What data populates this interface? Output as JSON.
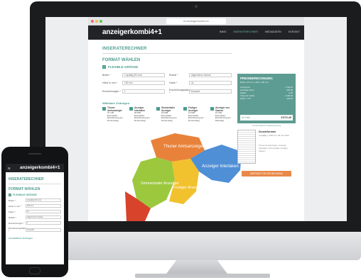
{
  "site": {
    "logo_text": "anzeigerkombi",
    "logo_num": "4+1",
    "url": "bi.anzeigerkombi.ch"
  },
  "nav": [
    "IMMO",
    "INSERATERECHNER",
    "MEDIADATEN",
    "KONTAKT"
  ],
  "main": {
    "title": "INSERATERECHNER",
    "format_title": "FORMAT WÄHLEN",
    "flex_label": "FLEXIBLE GRÖSSE",
    "fields": [
      {
        "label": "Breite *",
        "value": "2-spaltig (92 mm)"
      },
      {
        "label": "Rubrik *",
        "value": "Allgemeiner Inserat"
      },
      {
        "label": "Höhe in mm *",
        "value": "100 mm"
      },
      {
        "label": "Farbe *",
        "value": "4c"
      },
      {
        "label": "Erscheinungen *",
        "value": "1"
      },
      {
        "label": "Erscheinungsdatum *",
        "value": "Auswahl"
      }
    ],
    "regions_title": "Wählbare Zeitungen",
    "regions": [
      {
        "name": "Thuner Amtsanzeiger",
        "detail": "37 135 Exemplare Erscheinung am Donnerstag"
      },
      {
        "name": "Anzeiger Interlaken",
        "detail": "28 850 Exemplare Erscheinung am Donnerstag"
      },
      {
        "name": "Simmentaler Anzeiger",
        "detail": "18 508 Exemplare Erscheinung am Donnerstag"
      },
      {
        "name": "Frutiger Anzeiger",
        "detail": "14 845 Exemplare Erscheinung am Donnerstag"
      },
      {
        "name": "Anzeiger von Saanen",
        "detail": "10 636 Exemplare Erscheinung am Dienstag"
      }
    ],
    "map_labels": [
      "Thuner Amtsanzeiger",
      "Anzeiger Interlaken",
      "Simmentaler Anzeiger",
      "Frutiger Anzeiger"
    ]
  },
  "price_panel": {
    "title": "PREISBERECHNUNG",
    "subtitle": "Breite: 92 mm, Höhe: 100 mm",
    "rows": [
      {
        "label": "Grundpreis",
        "value": "2 782.10"
      },
      {
        "label": "Zuschlag Farbe",
        "value": "625.90"
      },
      {
        "label": "Rabatt",
        "value": "0.00"
      },
      {
        "label": "Total exkl. MwSt.",
        "value": "3 408.00"
      },
      {
        "label": "MwSt. 7.7%",
        "value": "262.40"
      }
    ],
    "total_label": "Ihr Preis",
    "total_value": "3'670.40",
    "note": "Unverbindliche Preisberechnung"
  },
  "preview": {
    "title": "Druckformat",
    "subtitle": "2-spaltig x 100 mm, 92 mm breit",
    "meta": "Thuner Amtsanzeiger, Anzeiger Interlaken, Simmentaler, Frutiger, Saanen",
    "cta": "ANFRAGE FÜR DIE BUCHUNG"
  },
  "mobile": {
    "logo_text": "anzeigerkombi",
    "logo_num": "4+1",
    "title": "INSERATERECHNER",
    "format_title": "FORMAT WÄHLEN",
    "flex_label": "FLEXIBLE GRÖSSE",
    "fields": [
      {
        "label": "Breite *",
        "value": "2-spaltig (92 mm)"
      },
      {
        "label": "Höhe in mm *",
        "value": "100 mm"
      },
      {
        "label": "Farbe *",
        "value": "4c"
      },
      {
        "label": "Rubrik *",
        "value": "Allgemeiner Inserat"
      },
      {
        "label": "Erscheinungen *",
        "value": "1"
      },
      {
        "label": "Erscheinungsdatum *",
        "value": "Auswahl"
      }
    ],
    "regions_title": "Auswählbare Zeitungen"
  },
  "colors": {
    "accent": "#4d9c8f",
    "panel": "#5d9c93",
    "cta": "#e8894a",
    "header": "#222326"
  }
}
